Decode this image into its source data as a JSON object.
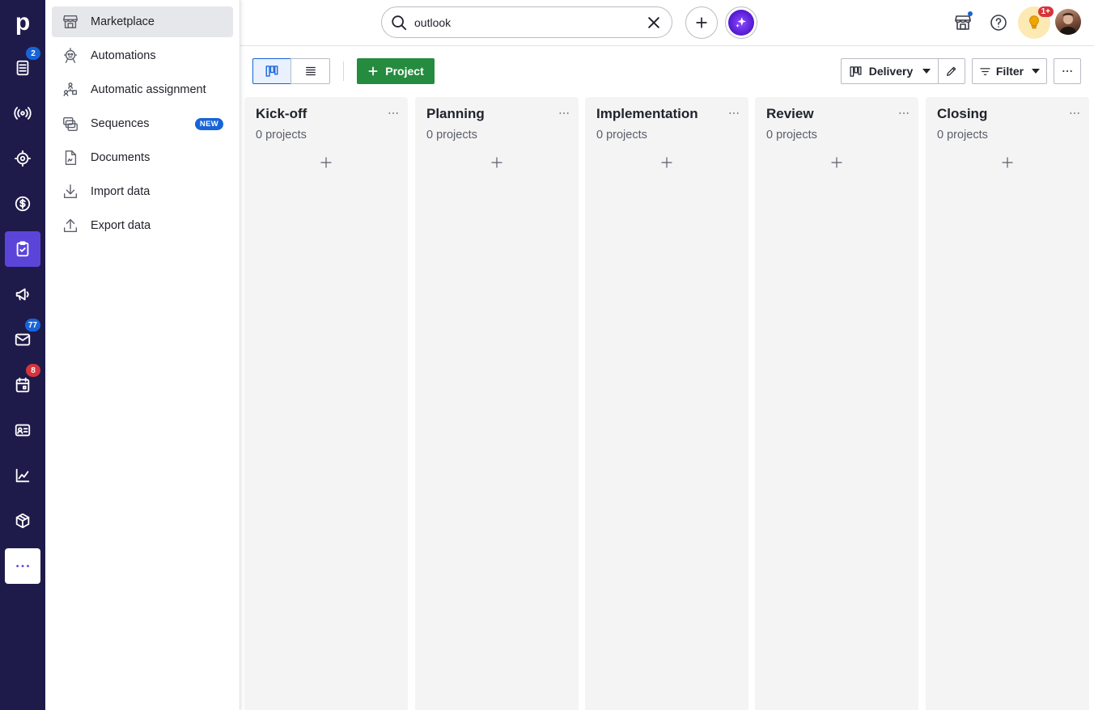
{
  "rail": {
    "logo": "p",
    "badges": {
      "leads": "2",
      "mail": "77",
      "activities": "8"
    },
    "colors": {
      "background": "#1e1b4b",
      "active": "#5b45d9",
      "badge_blue": "#1764d8",
      "badge_red": "#d6343b"
    }
  },
  "menu": {
    "items": [
      {
        "label": "Marketplace",
        "icon": "store-icon"
      },
      {
        "label": "Automations",
        "icon": "robot-icon"
      },
      {
        "label": "Automatic assignment",
        "icon": "assignment-icon"
      },
      {
        "label": "Sequences",
        "icon": "sequences-icon",
        "tag": "NEW"
      },
      {
        "label": "Documents",
        "icon": "document-icon"
      },
      {
        "label": "Import data",
        "icon": "import-icon"
      },
      {
        "label": "Export data",
        "icon": "export-icon"
      }
    ]
  },
  "topbar": {
    "search_value": "outlook",
    "notification_badge": "1+"
  },
  "toolbar": {
    "project_label": "Project",
    "pipeline_label": "Delivery",
    "filter_label": "Filter",
    "project_button_color": "#258b3f"
  },
  "board": {
    "columns": [
      {
        "title": "Kick-off",
        "count": "0 projects"
      },
      {
        "title": "Planning",
        "count": "0 projects"
      },
      {
        "title": "Implementation",
        "count": "0 projects"
      },
      {
        "title": "Review",
        "count": "0 projects"
      },
      {
        "title": "Closing",
        "count": "0 projects"
      }
    ]
  }
}
